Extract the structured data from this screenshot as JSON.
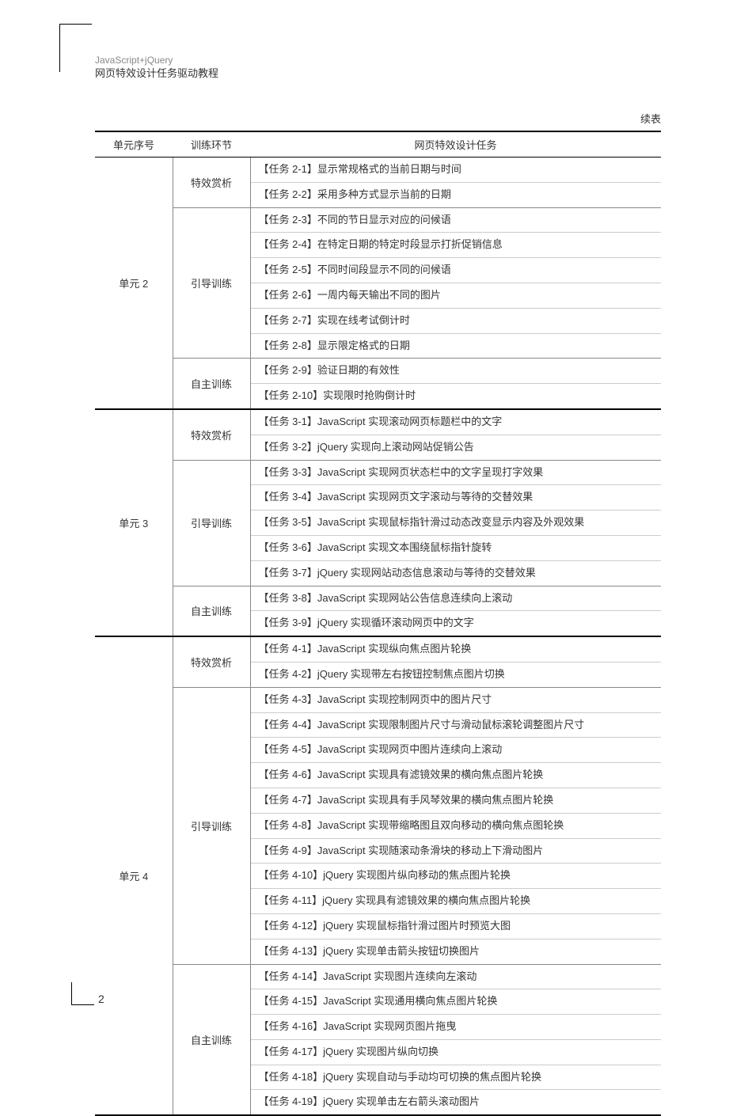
{
  "header": {
    "line1": "JavaScript+jQuery",
    "line2": "网页特效设计任务驱动教程"
  },
  "continued_label": "续表",
  "columns": {
    "unit": "单元序号",
    "phase": "训练环节",
    "task": "网页特效设计任务"
  },
  "units": [
    {
      "unit": "单元 2",
      "phases": [
        {
          "phase": "特效赏析",
          "tasks": [
            "【任务 2-1】显示常规格式的当前日期与时间",
            "【任务 2-2】采用多种方式显示当前的日期"
          ]
        },
        {
          "phase": "引导训练",
          "tasks": [
            "【任务 2-3】不同的节日显示对应的问候语",
            "【任务 2-4】在特定日期的特定时段显示打折促销信息",
            "【任务 2-5】不同时间段显示不同的问候语",
            "【任务 2-6】一周内每天输出不同的图片",
            "【任务 2-7】实现在线考试倒计时",
            "【任务 2-8】显示限定格式的日期"
          ]
        },
        {
          "phase": "自主训练",
          "tasks": [
            "【任务 2-9】验证日期的有效性",
            "【任务 2-10】实现限时抢购倒计时"
          ]
        }
      ]
    },
    {
      "unit": "单元 3",
      "phases": [
        {
          "phase": "特效赏析",
          "tasks": [
            "【任务 3-1】JavaScript 实现滚动网页标题栏中的文字",
            "【任务 3-2】jQuery 实现向上滚动网站促销公告"
          ]
        },
        {
          "phase": "引导训练",
          "tasks": [
            "【任务 3-3】JavaScript 实现网页状态栏中的文字呈现打字效果",
            "【任务 3-4】JavaScript 实现网页文字滚动与等待的交替效果",
            "【任务 3-5】JavaScript 实现鼠标指针滑过动态改变显示内容及外观效果",
            "【任务 3-6】JavaScript 实现文本围绕鼠标指针旋转",
            "【任务 3-7】jQuery 实现网站动态信息滚动与等待的交替效果"
          ]
        },
        {
          "phase": "自主训练",
          "tasks": [
            "【任务 3-8】JavaScript 实现网站公告信息连续向上滚动",
            "【任务 3-9】jQuery 实现循环滚动网页中的文字"
          ]
        }
      ]
    },
    {
      "unit": "单元 4",
      "phases": [
        {
          "phase": "特效赏析",
          "tasks": [
            "【任务 4-1】JavaScript 实现纵向焦点图片轮换",
            "【任务 4-2】jQuery 实现带左右按钮控制焦点图片切换"
          ]
        },
        {
          "phase": "引导训练",
          "tasks": [
            "【任务 4-3】JavaScript 实现控制网页中的图片尺寸",
            "【任务 4-4】JavaScript 实现限制图片尺寸与滑动鼠标滚轮调整图片尺寸",
            "【任务 4-5】JavaScript 实现网页中图片连续向上滚动",
            "【任务 4-6】JavaScript 实现具有滤镜效果的横向焦点图片轮换",
            "【任务 4-7】JavaScript 实现具有手风琴效果的横向焦点图片轮换",
            "【任务 4-8】JavaScript 实现带缩略图且双向移动的横向焦点图轮换",
            "【任务 4-9】JavaScript 实现随滚动条滑块的移动上下滑动图片",
            "【任务 4-10】jQuery 实现图片纵向移动的焦点图片轮换",
            "【任务 4-11】jQuery 实现具有滤镜效果的横向焦点图片轮换",
            "【任务 4-12】jQuery 实现鼠标指针滑过图片时预览大图",
            "【任务 4-13】jQuery 实现单击箭头按钮切换图片"
          ]
        },
        {
          "phase": "自主训练",
          "tasks": [
            "【任务 4-14】JavaScript 实现图片连续向左滚动",
            "【任务 4-15】JavaScript 实现通用横向焦点图片轮换",
            "【任务 4-16】JavaScript 实现网页图片拖曳",
            "【任务 4-17】jQuery 实现图片纵向切换",
            "【任务 4-18】jQuery 实现自动与手动均可切换的焦点图片轮换",
            "【任务 4-19】jQuery 实现单击左右箭头滚动图片"
          ]
        }
      ]
    }
  ],
  "page_number": "2"
}
